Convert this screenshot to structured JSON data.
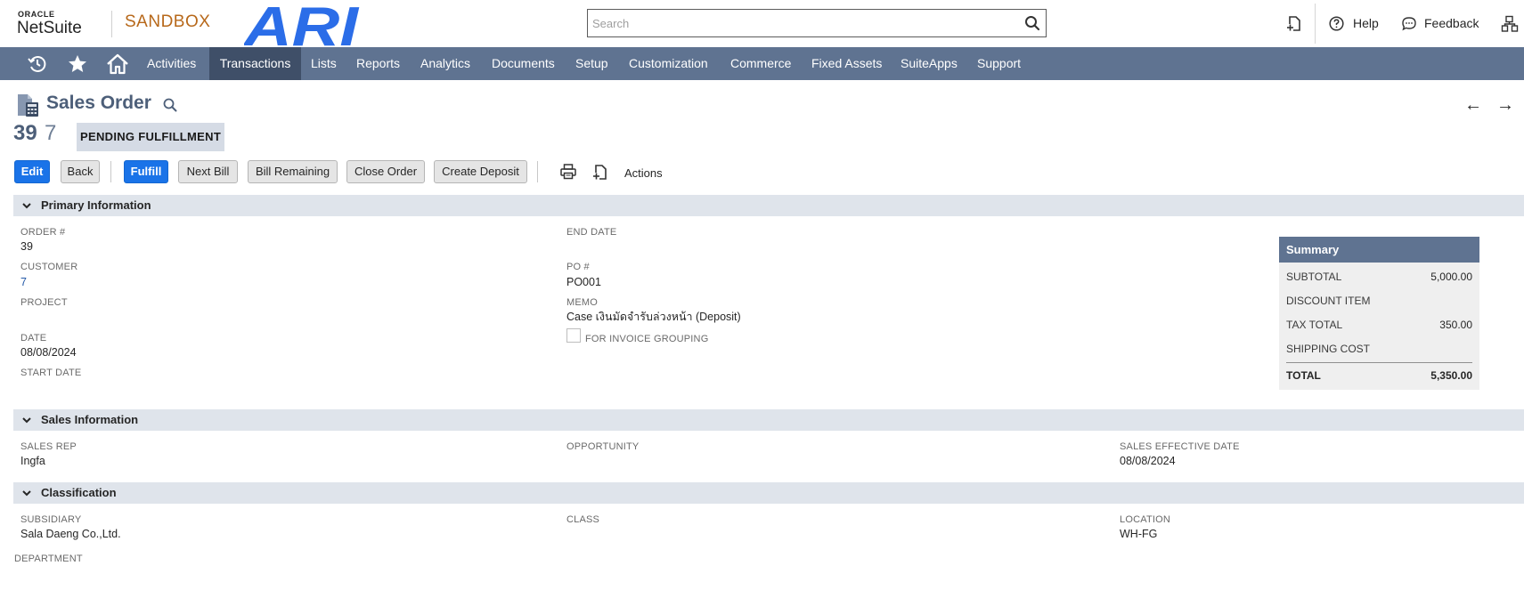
{
  "app": {
    "brand_top": "ORACLE",
    "brand_main": "NetSuite",
    "environment": "SANDBOX",
    "company_logo_text": "ARI"
  },
  "search": {
    "placeholder": "Search",
    "value": ""
  },
  "header": {
    "help_label": "Help",
    "feedback_label": "Feedback"
  },
  "nav": {
    "items": [
      {
        "label": "Activities"
      },
      {
        "label": "Transactions",
        "active": true
      },
      {
        "label": "Lists"
      },
      {
        "label": "Reports"
      },
      {
        "label": "Analytics"
      },
      {
        "label": "Documents"
      },
      {
        "label": "Setup"
      },
      {
        "label": "Customization"
      },
      {
        "label": "Commerce"
      },
      {
        "label": "Fixed Assets"
      },
      {
        "label": "SuiteApps"
      },
      {
        "label": "Support"
      }
    ],
    "icons": [
      "recent-records-icon",
      "star-icon",
      "home-icon"
    ]
  },
  "record": {
    "title": "Sales Order",
    "number": "39",
    "name": "7",
    "status": "PENDING FULFILLMENT",
    "prev_arrow": "←",
    "next_arrow": "→"
  },
  "buttons": {
    "edit": "Edit",
    "back": "Back",
    "fulfill": "Fulfill",
    "next_bill": "Next Bill",
    "bill_remaining": "Bill Remaining",
    "close_order": "Close Order",
    "create_deposit": "Create Deposit",
    "actions": "Actions"
  },
  "sections": {
    "primary": {
      "title": "Primary Information",
      "fields": {
        "order_no_label": "ORDER #",
        "order_no": "39",
        "customer_label": "CUSTOMER",
        "customer": "7",
        "project_label": "PROJECT",
        "project": "",
        "date_label": "DATE",
        "date": "08/08/2024",
        "start_date_label": "START DATE",
        "start_date": "",
        "end_date_label": "END DATE",
        "end_date": "",
        "po_label": "PO #",
        "po": "PO001",
        "memo_label": "MEMO",
        "memo": "Case เงินมัดจำรับล่วงหน้า (Deposit)",
        "invoice_grouping_label": "FOR INVOICE GROUPING",
        "invoice_grouping_checked": false
      }
    },
    "sales": {
      "title": "Sales Information",
      "fields": {
        "sales_rep_label": "SALES REP",
        "sales_rep": "Ingfa",
        "opportunity_label": "OPPORTUNITY",
        "opportunity": "",
        "sales_effective_date_label": "SALES EFFECTIVE DATE",
        "sales_effective_date": "08/08/2024"
      }
    },
    "classification": {
      "title": "Classification",
      "fields": {
        "subsidiary_label": "SUBSIDIARY",
        "subsidiary": "Sala Daeng Co.,Ltd.",
        "class_label": "CLASS",
        "class": "",
        "location_label": "LOCATION",
        "location": "WH-FG",
        "department_label": "DEPARTMENT",
        "department": ""
      }
    }
  },
  "summary": {
    "title": "Summary",
    "subtotal_label": "SUBTOTAL",
    "subtotal": "5,000.00",
    "discount_label": "DISCOUNT ITEM",
    "discount": "",
    "tax_label": "TAX TOTAL",
    "tax": "350.00",
    "shipping_label": "SHIPPING COST",
    "shipping": "",
    "total_label": "TOTAL",
    "total": "5,350.00"
  },
  "colors": {
    "nav_bg": "#5f7391",
    "nav_active": "#3f4f68",
    "primary_button": "#1a73e8",
    "sandbox_text": "#b7681a",
    "ari_logo": "#2b6de8",
    "section_bar": "#dfe4eb",
    "link": "#255aa8"
  }
}
